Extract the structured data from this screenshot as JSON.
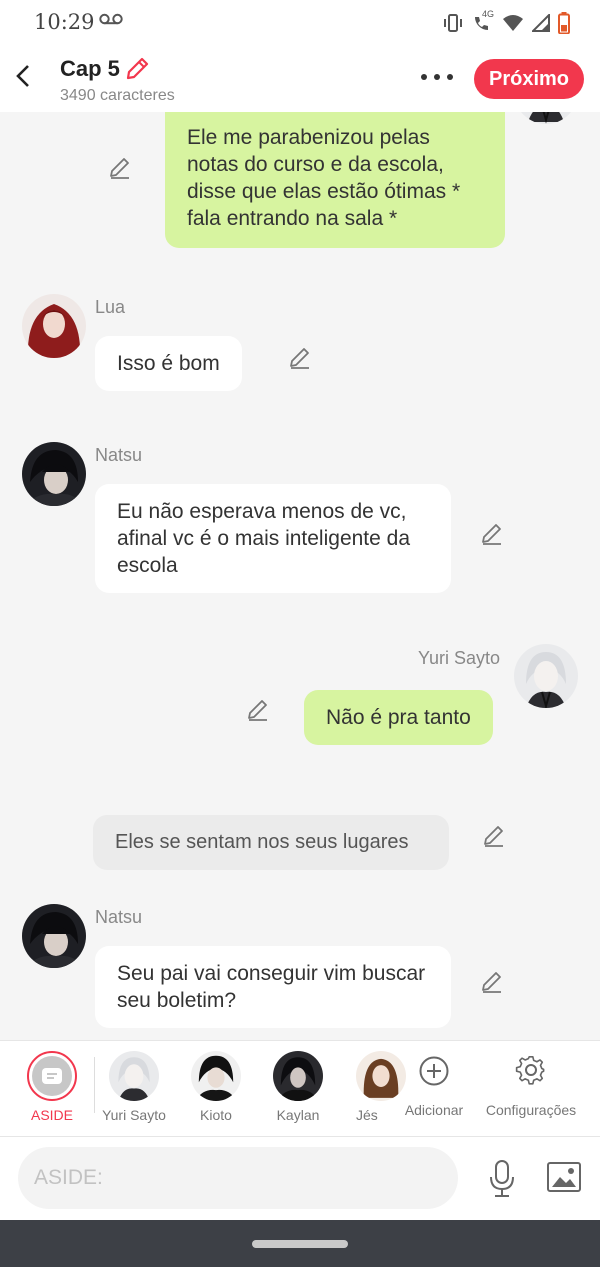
{
  "status_bar": {
    "time": "10:29",
    "net_label": "4G"
  },
  "header": {
    "title": "Cap 5",
    "subtitle": "3490 caracteres",
    "next_label": "Próximo"
  },
  "messages": [
    {
      "speaker": "Yuri Sayto",
      "side": "right",
      "text": "Ele me parabenizou pelas notas do curso e da escola, disse que elas estão ótimas * fala entrando na sala *"
    },
    {
      "speaker": "Lua",
      "side": "left",
      "text": "Isso é bom"
    },
    {
      "speaker": "Natsu",
      "side": "left",
      "text": "Eu não esperava menos de vc, afinal vc é o mais inteligente da escola"
    },
    {
      "speaker": "Yuri Sayto",
      "side": "right",
      "text": "Não é pra tanto"
    },
    {
      "speaker": "ASIDE",
      "side": "center",
      "text": "Eles se sentam nos seus lugares"
    },
    {
      "speaker": "Natsu",
      "side": "left",
      "text": "Seu pai vai conseguir vim buscar seu boletim?"
    }
  ],
  "characters": [
    {
      "label": "ASIDE",
      "active": true
    },
    {
      "label": "Yuri Sayto"
    },
    {
      "label": "Kioto"
    },
    {
      "label": "Kaylan"
    },
    {
      "label": "Jés"
    }
  ],
  "tools": {
    "add_label": "Adicionar",
    "settings_label": "Configurações"
  },
  "composer": {
    "placeholder": "ASIDE:"
  },
  "colors": {
    "accent": "#f2374d",
    "green_bubble": "#d7f4a0",
    "white_bubble": "#ffffff"
  }
}
